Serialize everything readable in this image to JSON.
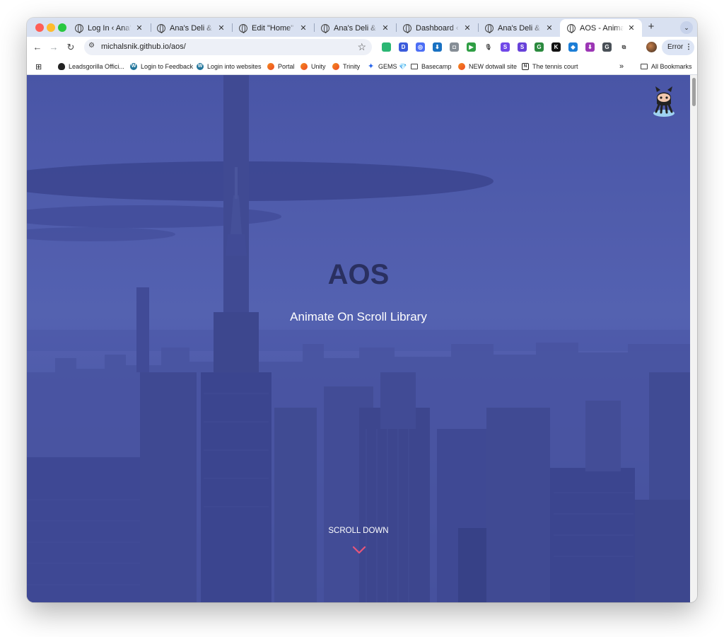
{
  "browser": {
    "tabs": [
      {
        "title": "Log In ‹ Ana's Deli",
        "active": false
      },
      {
        "title": "Ana's Deli & Cafe",
        "active": false
      },
      {
        "title": "Edit \"Home\" with",
        "active": false
      },
      {
        "title": "Ana's Deli & Cafe",
        "active": false
      },
      {
        "title": "Dashboard ‹ Ana's",
        "active": false
      },
      {
        "title": "Ana's Deli & Cafe",
        "active": false
      },
      {
        "title": "AOS - Animate on",
        "active": true
      }
    ],
    "url": "michalsnik.github.io/aos/",
    "profile_button_label": "Error",
    "extensions": [
      {
        "icon": "extension-icon",
        "letter": "",
        "color": "#2bb673"
      },
      {
        "icon": "extension-icon",
        "letter": "D",
        "color": "#3b5bdb"
      },
      {
        "icon": "extension-icon",
        "letter": "◎",
        "color": "#4c6ef5"
      },
      {
        "icon": "extension-icon",
        "letter": "⬇",
        "color": "#1971c2"
      },
      {
        "icon": "camera-icon",
        "letter": "◘",
        "color": "#868e96"
      },
      {
        "icon": "extension-icon",
        "letter": "▶",
        "color": "#2f9e44"
      },
      {
        "icon": "microphone-icon",
        "letter": "🎙",
        "color": "#ffffff"
      },
      {
        "icon": "extension-icon",
        "letter": "S",
        "color": "#7048e8"
      },
      {
        "icon": "extension-icon",
        "letter": "S",
        "color": "#6741d9"
      },
      {
        "icon": "extension-icon",
        "letter": "G",
        "color": "#2b8a3e"
      },
      {
        "icon": "extension-icon",
        "letter": "K",
        "color": "#111111"
      },
      {
        "icon": "tag-icon",
        "letter": "◆",
        "color": "#1c7ed6"
      },
      {
        "icon": "extension-icon",
        "letter": "⬇",
        "color": "#9c36b5"
      },
      {
        "icon": "extension-icon",
        "letter": "G",
        "color": "#495057"
      },
      {
        "icon": "puzzle-icon",
        "letter": "⧉",
        "color": "#ffffff"
      }
    ]
  },
  "bookmarks": [
    {
      "label": "Leadsgorilla Offici...",
      "icon": "flame-icon"
    },
    {
      "label": "Login to Feedback",
      "icon": "wordpress-icon"
    },
    {
      "label": "Login into websites",
      "icon": "wordpress-icon"
    },
    {
      "label": "Portal",
      "icon": "link-icon"
    },
    {
      "label": "Unity",
      "icon": "link-icon"
    },
    {
      "label": "Trinity",
      "icon": "link-icon"
    },
    {
      "label": "GEMS 💎",
      "icon": "sparkle-icon"
    },
    {
      "label": "Basecamp",
      "icon": "folder-icon"
    },
    {
      "label": "NEW dotwall site",
      "icon": "link-icon"
    },
    {
      "label": "The tennis court",
      "icon": "notion-icon"
    }
  ],
  "all_bookmarks_label": "All Bookmarks",
  "hero": {
    "title": "AOS",
    "subtitle": "Animate On Scroll Library",
    "scroll_label": "SCROLL DOWN"
  },
  "colors": {
    "overlay": "#4e5aa8",
    "title": "#2a3060",
    "chevron": "#e8557a"
  }
}
